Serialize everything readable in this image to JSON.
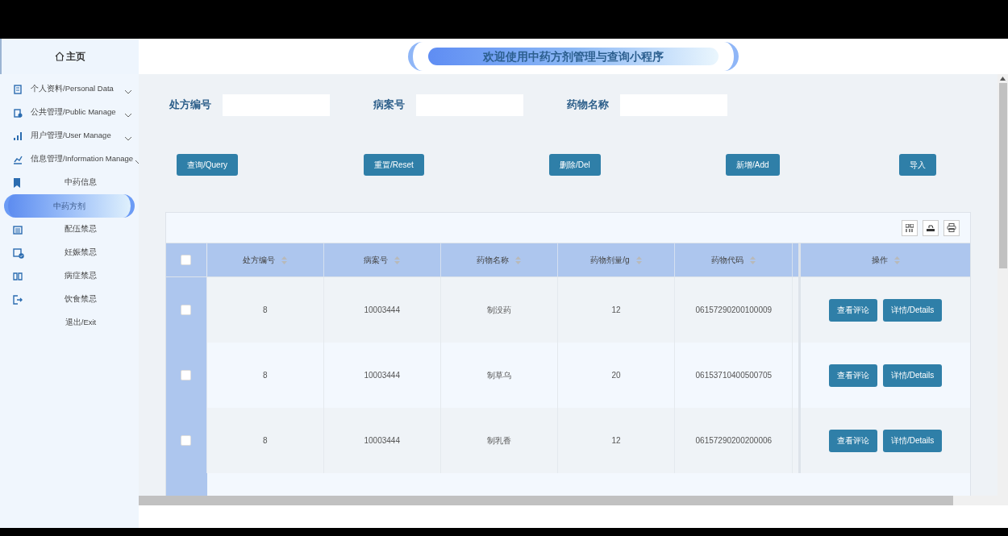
{
  "sidebar": {
    "home": "主页",
    "items": [
      {
        "label": "个人资料/Personal Data",
        "kind": "group",
        "expanded": false,
        "selected": false
      },
      {
        "label": "公共管理/Public Manage",
        "kind": "group",
        "expanded": false,
        "selected": false
      },
      {
        "label": "用户管理/User Manage",
        "kind": "group",
        "expanded": false,
        "selected": false
      },
      {
        "label": "信息管理/Information Manage",
        "kind": "group",
        "expanded": false,
        "selected": false
      },
      {
        "label": "中药信息",
        "kind": "link",
        "selected": false
      },
      {
        "label": "中药方剂",
        "kind": "link",
        "selected": true
      },
      {
        "label": "配伍禁忌",
        "kind": "link",
        "selected": false
      },
      {
        "label": "妊娠禁忌",
        "kind": "link",
        "selected": false
      },
      {
        "label": "病症禁忌",
        "kind": "link",
        "selected": false
      },
      {
        "label": "饮食禁忌",
        "kind": "link",
        "selected": false
      },
      {
        "label": "退出/Exit",
        "kind": "link",
        "selected": false
      }
    ]
  },
  "header": {
    "title": "欢迎使用中药方剂管理与查询小程序"
  },
  "filters": [
    {
      "label": "处方编号"
    },
    {
      "label": "病案号"
    },
    {
      "label": "药物名称"
    }
  ],
  "buttons": [
    "查询/Query",
    "重置/Reset",
    "删除/Del",
    "新增/Add",
    "导入"
  ],
  "table": {
    "select_all": {
      "checked": false
    },
    "columns": [
      {
        "label": "处方编号"
      },
      {
        "label": "病案号"
      },
      {
        "label": "药物名称"
      },
      {
        "label": "药物剂量/g"
      },
      {
        "label": "药物代码"
      }
    ],
    "action_column": "操作",
    "rows": [
      {
        "checked": false,
        "cells": [
          "8",
          "10003444",
          "制没药",
          "12",
          "06157290200100009"
        ],
        "actions": [
          "查看评论",
          "详情/Details"
        ]
      },
      {
        "checked": false,
        "cells": [
          "8",
          "10003444",
          "制草乌",
          "20",
          "06153710400500705"
        ],
        "actions": [
          "查看评论",
          "详情/Details"
        ]
      },
      {
        "checked": false,
        "cells": [
          "8",
          "10003444",
          "制乳香",
          "12",
          "06157290200200006"
        ],
        "actions": [
          "查看评论",
          "详情/Details"
        ]
      }
    ]
  }
}
